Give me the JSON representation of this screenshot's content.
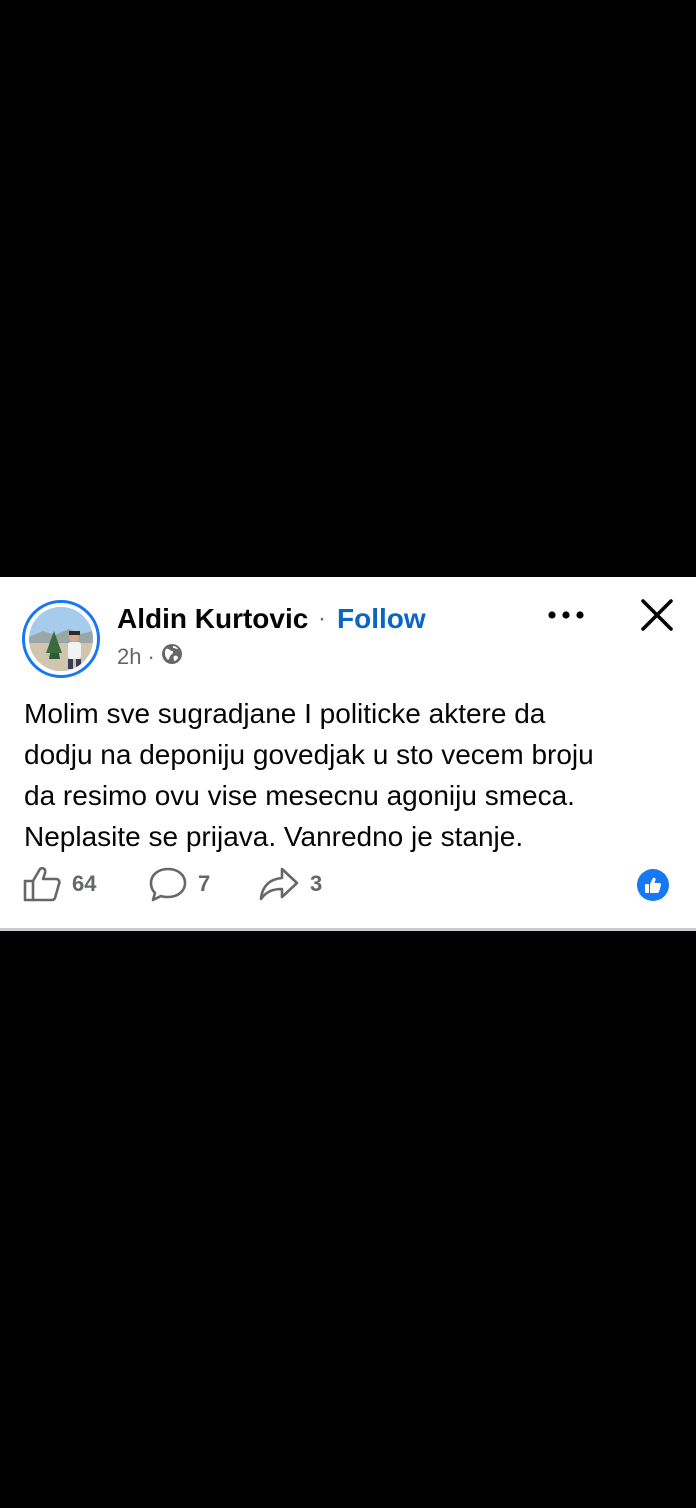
{
  "post": {
    "author": "Aldin Kurtovic",
    "separator": "·",
    "follow_label": "Follow",
    "time": "2h",
    "meta_separator": "·",
    "privacy_icon": "globe-icon",
    "text_lines": [
      "Molim sve sugradjane I politicke aktere da",
      "dodju na deponiju govedjak u sto vecem broju",
      "da resimo ovu vise mesecnu agoniju smeca.",
      "Neplasite se prijava. Vanredno je stanje."
    ],
    "likes": "64",
    "comments": "7",
    "shares": "3"
  },
  "icons": {
    "more": "more-horizontal-icon",
    "close": "close-icon",
    "like": "thumbs-up-icon",
    "comment": "comment-bubble-icon",
    "share": "share-arrow-icon",
    "reaction": "like-reaction-icon"
  },
  "colors": {
    "background": "#000000",
    "card": "#ffffff",
    "accent": "#1877f2",
    "follow": "#0a66c2",
    "secondary_text": "#65676b",
    "primary_text": "#050505"
  }
}
